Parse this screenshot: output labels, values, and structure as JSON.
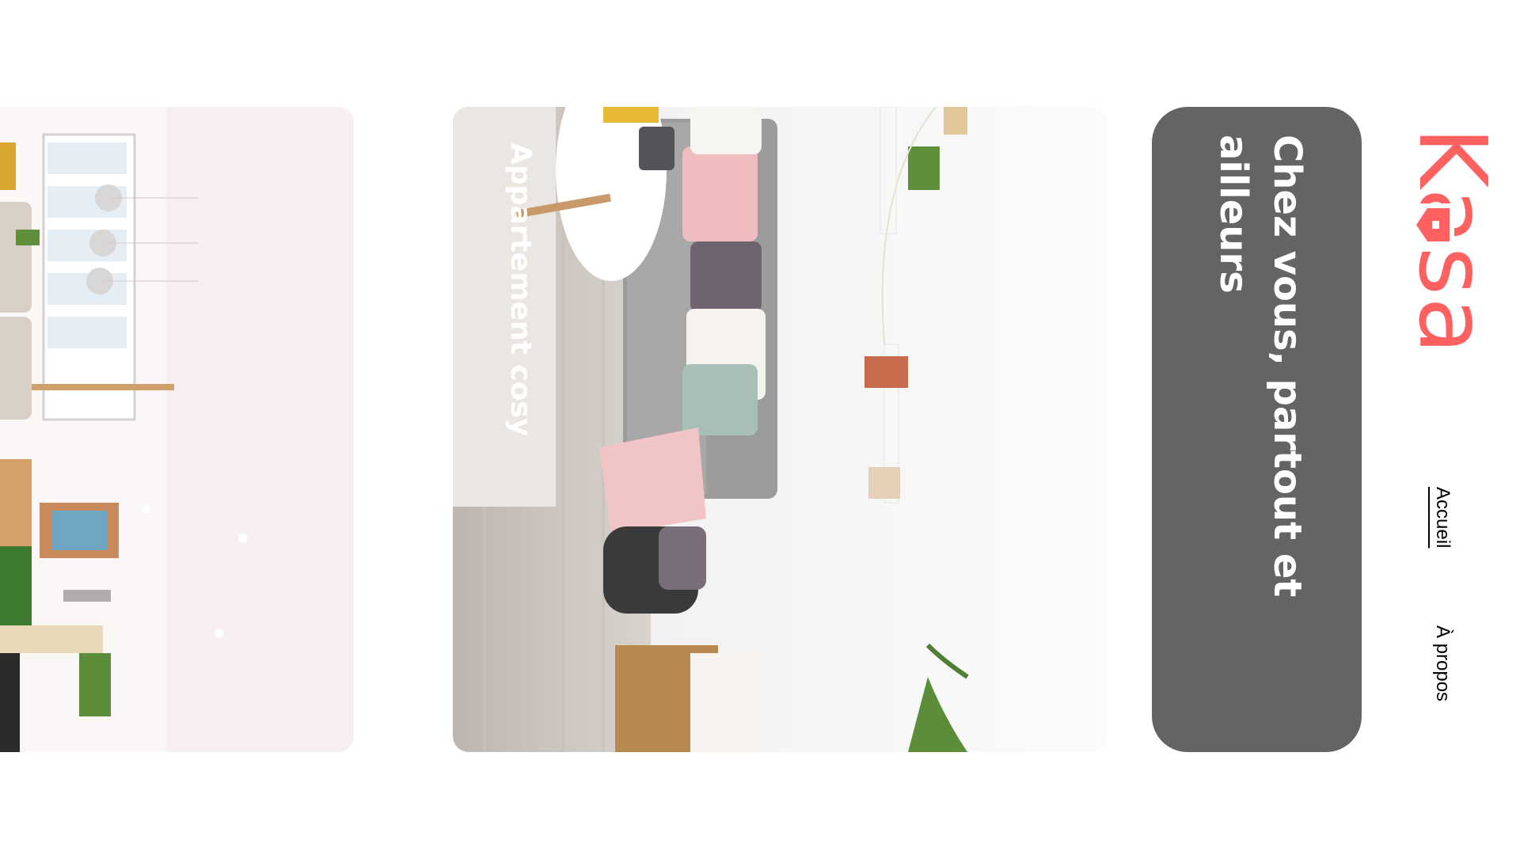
{
  "brand": {
    "logo_text": "Kasa",
    "accent_color": "#FF6060"
  },
  "nav": {
    "home_label": "Accueil",
    "about_label": "À propos"
  },
  "banner": {
    "title": "Chez vous, partout et ailleurs",
    "background": "#646464"
  },
  "cards": [
    {
      "title": "Appartement cosy",
      "image": "living-room-photo"
    },
    {
      "title": "",
      "image": "bright-apartment-photo"
    }
  ]
}
